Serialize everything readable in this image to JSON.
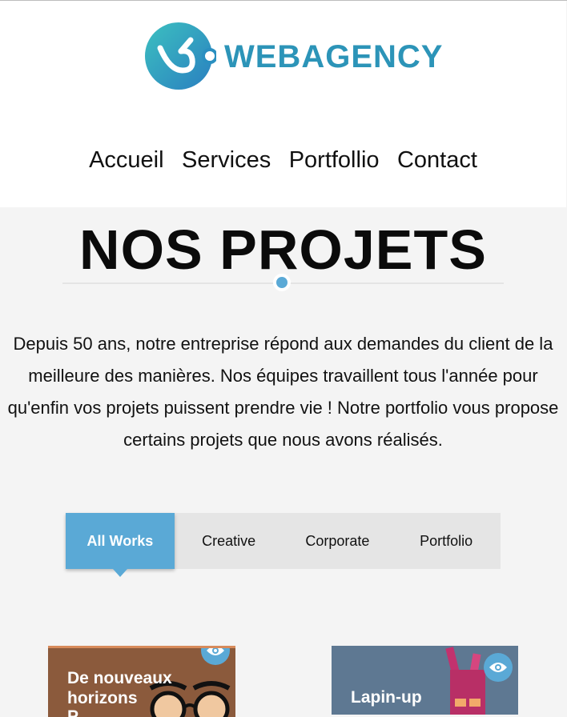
{
  "brand": {
    "name": "WEBAGENCY",
    "color": "#2c94b8"
  },
  "nav": {
    "items": [
      "Accueil",
      "Services",
      "Portfollio",
      "Contact"
    ]
  },
  "section": {
    "title": "NOS PROJETS",
    "intro": "Depuis 50 ans, notre entreprise répond aux demandes du client de la meilleure des manières. Nos équipes travaillent tous l'année pour qu'enfin vos projets puissent prendre vie ! Notre portfolio vous propose certains projets que nous avons réalisés."
  },
  "filters": {
    "tabs": [
      "All Works",
      "Creative",
      "Corporate",
      "Portfolio"
    ],
    "active": "All Works"
  },
  "projects": [
    {
      "title": "De nouveaux horizons",
      "subtitle": "P",
      "icon": "eye-icon"
    },
    {
      "title": "Lapin-up",
      "icon": "eye-icon"
    }
  ],
  "colors": {
    "accent": "#5aa9d6",
    "page_bg": "#f4f4f4",
    "tabs_bg": "#e5e5e5"
  }
}
